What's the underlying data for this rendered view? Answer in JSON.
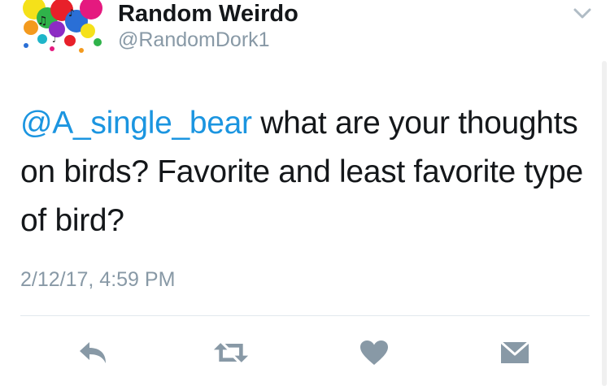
{
  "author": {
    "display_name": "Random Weirdo",
    "handle": "@RandomDork1"
  },
  "tweet": {
    "mention": "@A_single_bear",
    "body": " what are your thoughts on birds? Favorite and least favorite type of bird?",
    "timestamp": "2/12/17, 4:59 PM"
  },
  "icons": {
    "menu": "chevron-down-icon",
    "reply": "reply-icon",
    "retweet": "retweet-icon",
    "like": "heart-icon",
    "message": "envelope-icon"
  },
  "colors": {
    "text": "#14171a",
    "secondary": "#8899a6",
    "link": "#1b95e0",
    "action_icon": "#8899a6",
    "divider": "#e1e8ed"
  }
}
